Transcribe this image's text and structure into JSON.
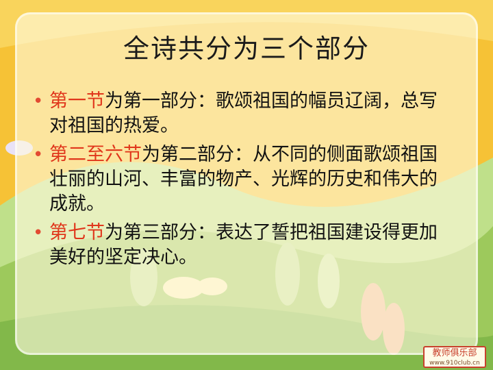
{
  "slide": {
    "title": "全诗共分为三个部分",
    "bullets": [
      {
        "highlight": "第一节",
        "text": "为第一部分：歌颂祖国的幅员辽阔，总写对祖国的热爱。"
      },
      {
        "highlight": "第二至六节",
        "text": "为第二部分：从不同的侧面歌颂祖国壮丽的山河、丰富的物产、光辉的历史和伟大的成就。"
      },
      {
        "highlight": "第七节",
        "text": "为第三部分：表达了誓把祖国建设得更加美好的坚定决心。"
      }
    ],
    "bullet_symbol": "•"
  },
  "logo": {
    "main": "教师俱乐部",
    "url": "www.910club.cn"
  },
  "colors": {
    "background": "#f7c33a",
    "highlight": "#e0361b",
    "hill": "#a9cf6a",
    "tree": "#cde3a1"
  }
}
